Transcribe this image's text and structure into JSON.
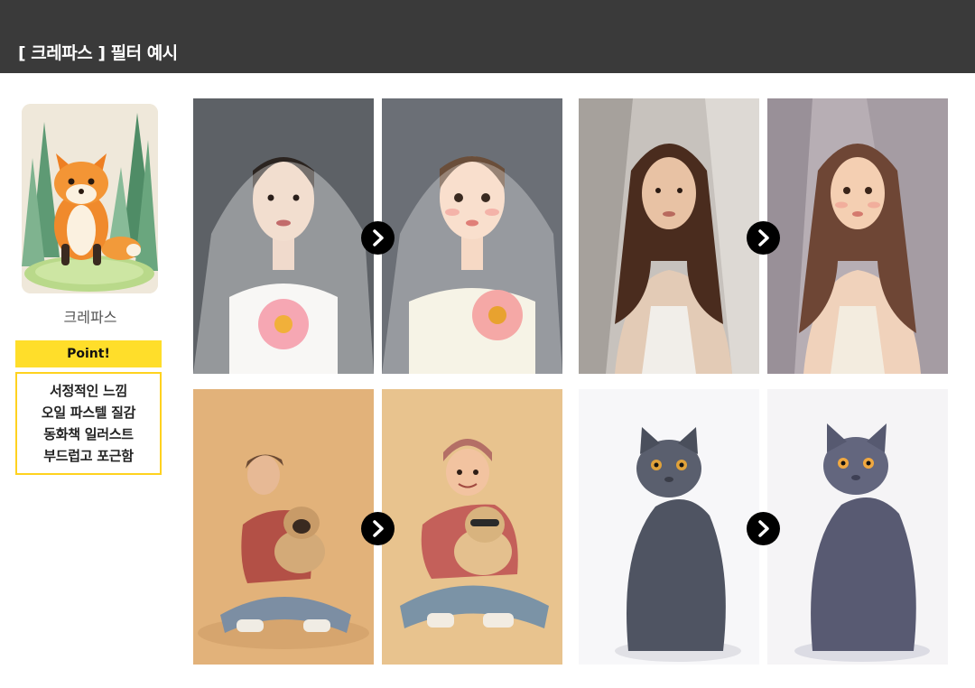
{
  "header": {
    "title": "[ 크레파스 ] 필터 예시"
  },
  "sidebar": {
    "thumbnail_icon": "fox-illustration",
    "caption": "크레파스",
    "point_label": "Point!",
    "points": [
      "서정적인 느낌",
      "오일 파스텔 질감",
      "동화책 일러스트",
      "부드럽고 포근함"
    ]
  },
  "examples": [
    {
      "subject": "bride-with-veil",
      "before": "photo",
      "after": "crayon-illustration"
    },
    {
      "subject": "woman-long-hair",
      "before": "photo",
      "after": "crayon-illustration"
    },
    {
      "subject": "person-with-pug",
      "before": "photo",
      "after": "crayon-illustration"
    },
    {
      "subject": "gray-cat",
      "before": "photo",
      "after": "crayon-illustration"
    }
  ],
  "icons": {
    "arrow": "chevron-right-icon"
  },
  "colors": {
    "header_bg": "#3a3a3a",
    "accent_yellow": "#ffde2a",
    "border_yellow": "#ffd21f"
  }
}
